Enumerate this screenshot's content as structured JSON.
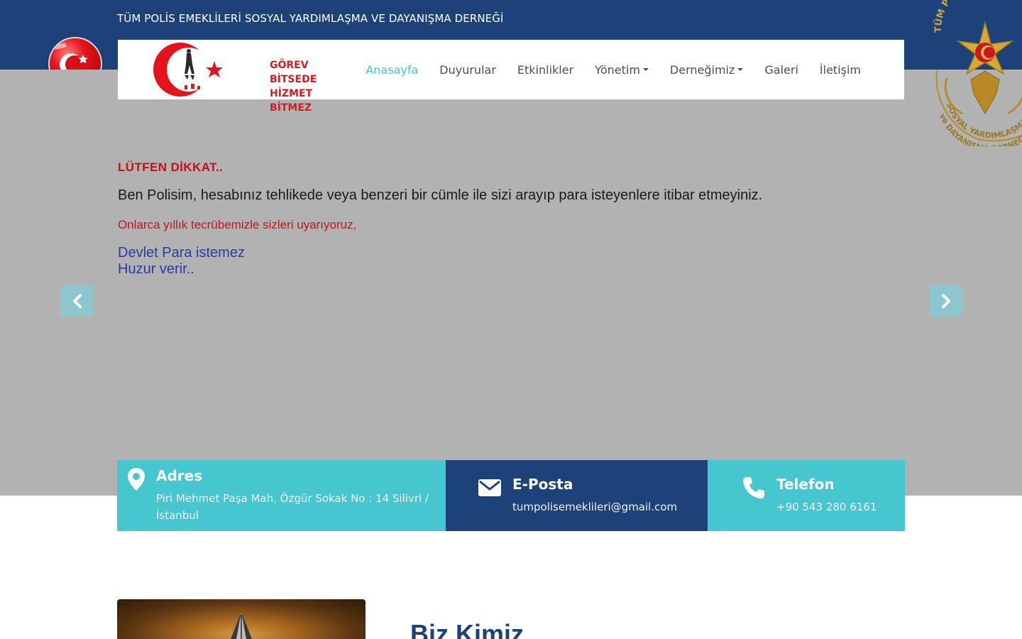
{
  "header": {
    "org_name": "TÜM POLİS EMEKLİLERİ SOSYAL YARDIMLAŞMA VE DAYANIŞMA DERNEĞİ"
  },
  "brand": {
    "line1": "GÖREV BİTSEDE",
    "line2": "HİZMET BİTMEZ",
    "color": "#d31b22"
  },
  "nav": {
    "items": [
      {
        "label": "Anasayfa",
        "active": true
      },
      {
        "label": "Duyurular"
      },
      {
        "label": "Etkinlikler"
      },
      {
        "label": "Yönetim",
        "dropdown": true
      },
      {
        "label": "Derneğimiz",
        "dropdown": true
      },
      {
        "label": "Galeri"
      },
      {
        "label": "İletişim"
      }
    ]
  },
  "emblem": {
    "text_top": "TÜM POLİS EMEKLİLERİ",
    "text_bottom1": "SOSYAL YARDIMLAŞMA",
    "text_bottom2": "ve DAYANIŞMA DERNEĞİ"
  },
  "slider": {
    "title": "LÜTFEN DİKKAT..",
    "line1": "Ben Polisim, hesabınız tehlikede veya benzeri bir cümle ile sizi arayıp para isteyenlere itibar etmeyiniz.",
    "line2": "Onlarca yıllık tecrübemizle sizleri uyarıyoruz,",
    "line3a": "Devlet Para istemez",
    "line3b": "Huzur verir.."
  },
  "contact": {
    "address": {
      "title": "Adres",
      "line1": "Piri Mehmet Paşa Mah, Özgür Sokak No : 14 Silivri /",
      "line2": "İstanbul",
      "icon": "map-marker-icon"
    },
    "email": {
      "title": "E-Posta",
      "value": "tumpolisemeklileri@gmail.com",
      "icon": "envelope-icon"
    },
    "phone": {
      "title": "Telefon",
      "value": "+90 543 280 6161",
      "icon": "phone-icon"
    }
  },
  "about": {
    "title": "Biz Kimiz"
  },
  "colors": {
    "navy": "#1d4279",
    "teal": "#46c6ce",
    "active_nav": "#48c6cf",
    "hero_bg": "#b2b2b2"
  }
}
